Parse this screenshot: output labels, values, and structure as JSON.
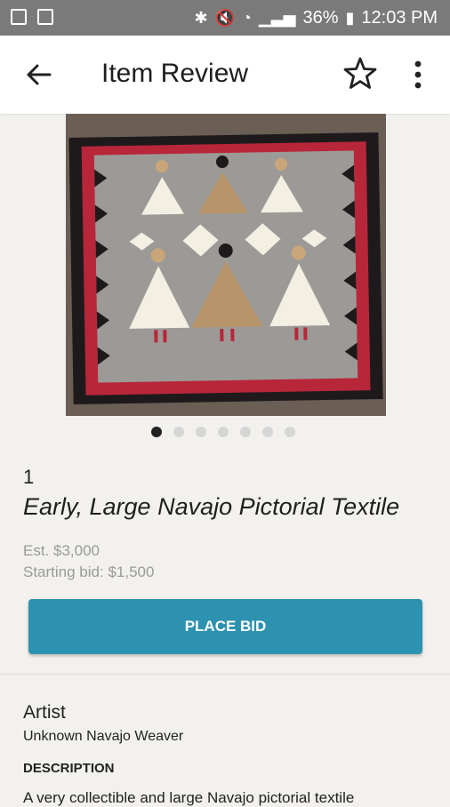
{
  "status_bar": {
    "battery": "36%",
    "time": "12:03 PM",
    "icons": [
      "image-icon",
      "checkbox-icon",
      "bluetooth-icon",
      "mute-icon",
      "wifi-icon",
      "signal-icon",
      "battery-icon"
    ]
  },
  "app_bar": {
    "title": "Item Review",
    "icons": [
      "back-arrow-icon",
      "star-icon",
      "more-vertical-icon"
    ]
  },
  "carousel": {
    "total": 7,
    "active_index": 0
  },
  "lot": {
    "number": "1",
    "title": "Early, Large Navajo Pictorial Textile",
    "estimate": "Est. $3,000",
    "starting_bid": "Starting bid: $1,500"
  },
  "actions": {
    "place_bid": "PLACE BID"
  },
  "details": {
    "artist_label": "Artist",
    "artist_value": "Unknown Navajo Weaver",
    "description_label": "DESCRIPTION",
    "description_text": "A very collectible and large Navajo pictorial textile"
  },
  "colors": {
    "accent": "#2d92b0",
    "status_bar": "#7a7a7a"
  }
}
